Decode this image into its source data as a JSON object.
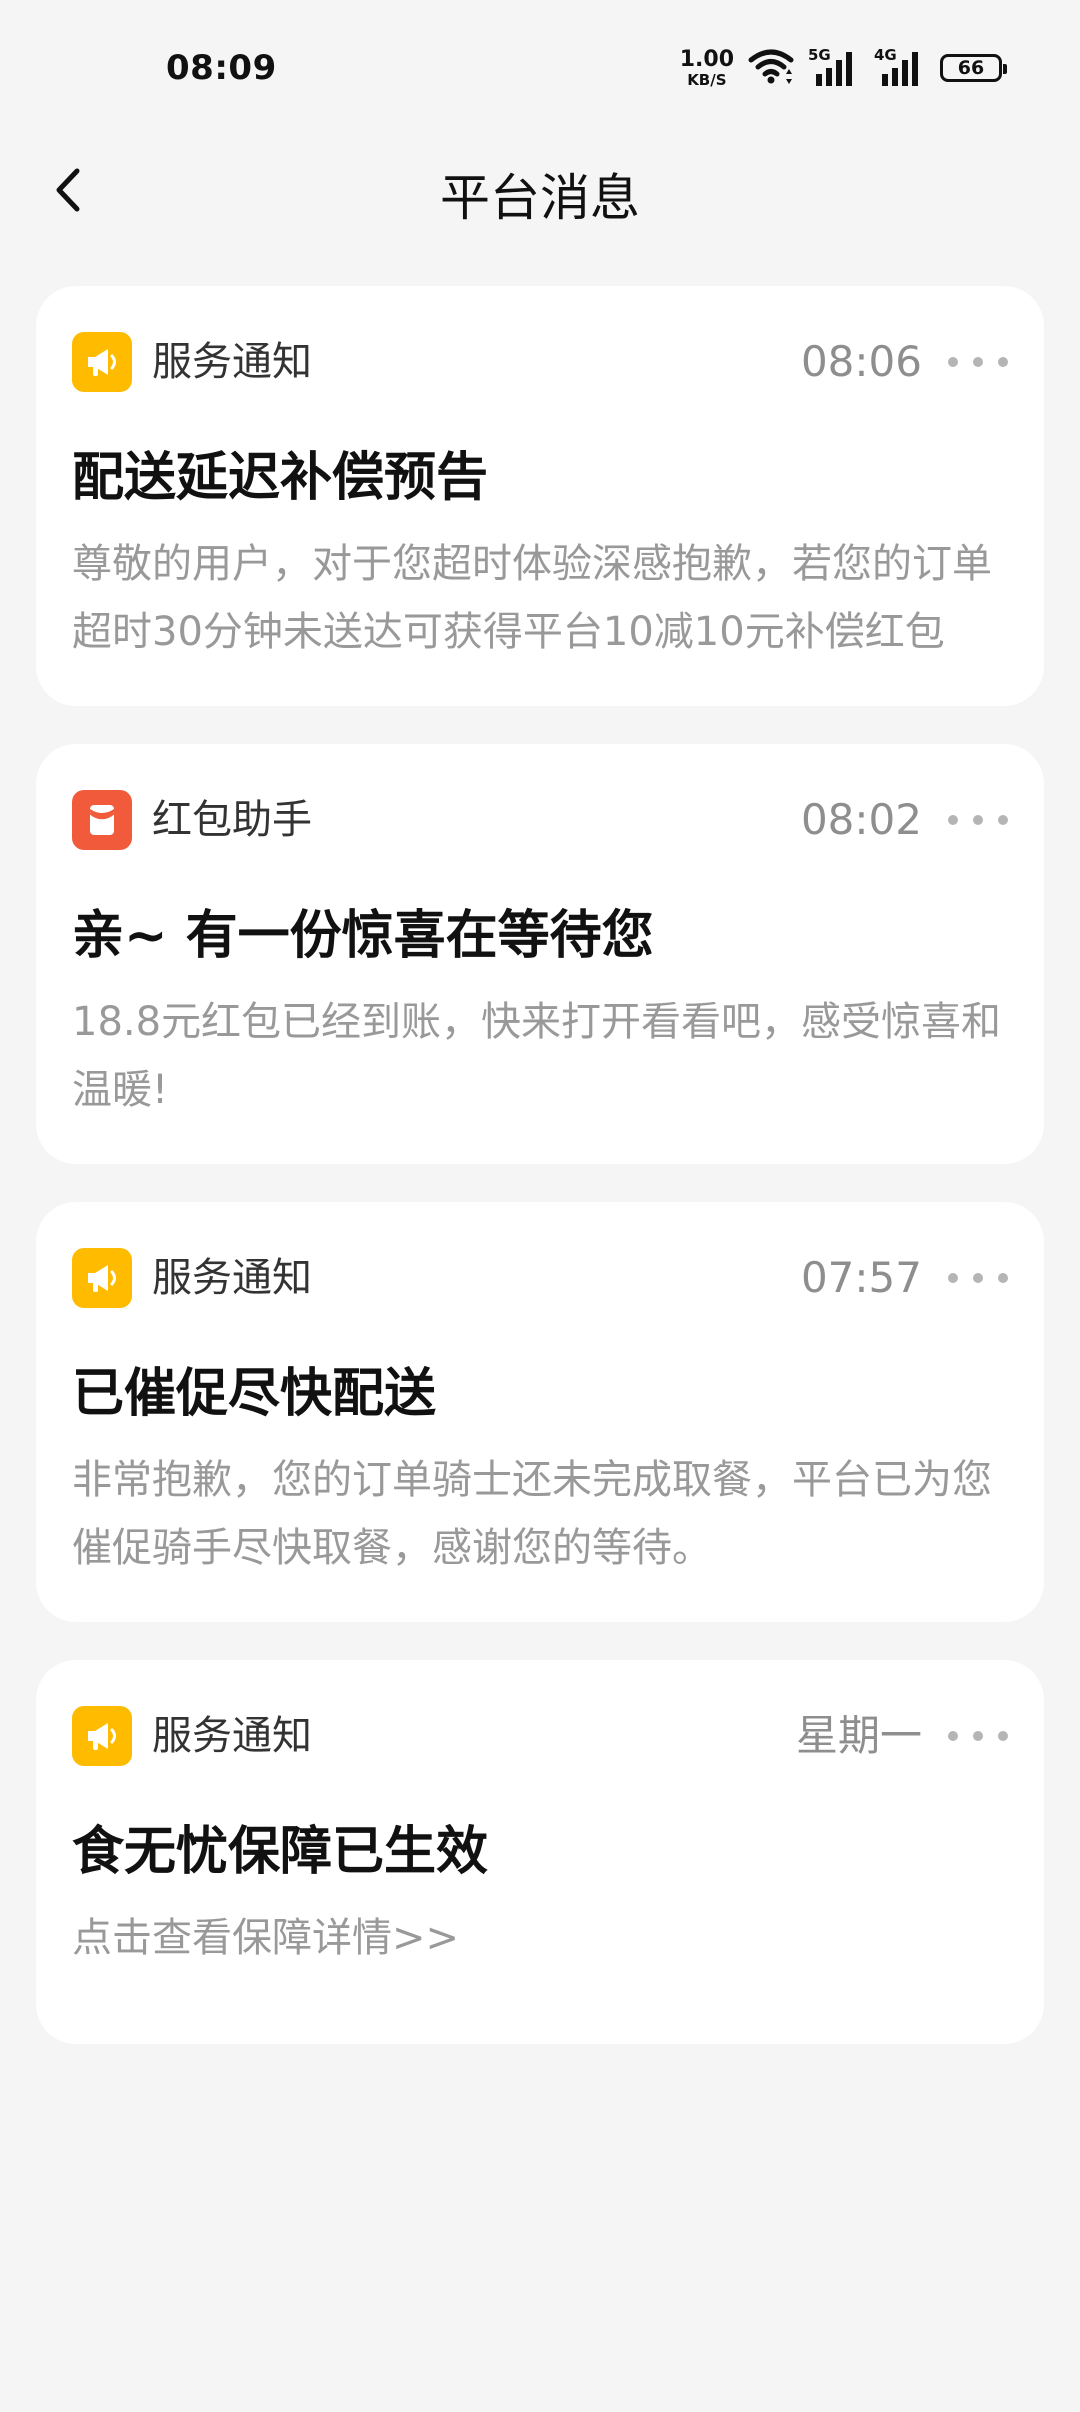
{
  "status_bar": {
    "time": "08:09",
    "net_speed_value": "1.00",
    "net_speed_unit": "KB/S",
    "signal1_label": "5G",
    "signal2_label": "4G",
    "battery": "66"
  },
  "header": {
    "title": "平台消息"
  },
  "messages": [
    {
      "source": "服务通知",
      "source_icon": "megaphone-icon",
      "time": "08:06",
      "title": "配送延迟补偿预告",
      "body": "尊敬的用户，对于您超时体验深感抱歉，若您的订单超时30分钟未送达可获得平台10减10元补偿红包"
    },
    {
      "source": "红包助手",
      "source_icon": "red-envelope-icon",
      "time": "08:02",
      "title": "亲~ 有一份惊喜在等待您",
      "body": "18.8元红包已经到账，快来打开看看吧，感受惊喜和温暖!"
    },
    {
      "source": "服务通知",
      "source_icon": "megaphone-icon",
      "time": "07:57",
      "title": "已催促尽快配送",
      "body": "非常抱歉，您的订单骑士还未完成取餐，平台已为您催促骑手尽快取餐，感谢您的等待。"
    },
    {
      "source": "服务通知",
      "source_icon": "megaphone-icon",
      "time": "星期一",
      "title": "食无忧保障已生效",
      "body": "点击查看保障详情>>"
    }
  ],
  "colors": {
    "service_icon_bg": "#ffbb00",
    "redpacket_icon_bg": "#f25a3c",
    "page_bg": "#f5f5f5"
  }
}
